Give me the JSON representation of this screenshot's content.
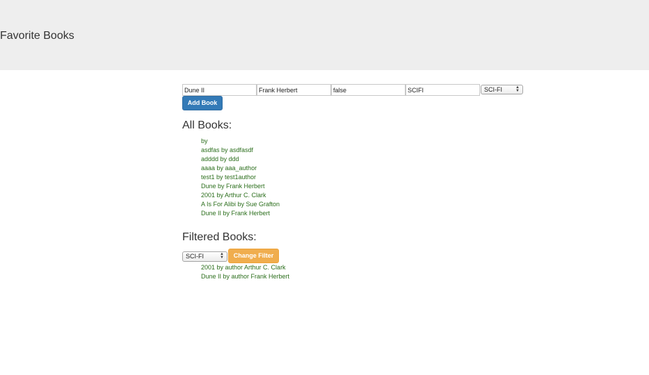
{
  "header": {
    "title": "Favorite Books"
  },
  "form": {
    "title_value": "Dune II",
    "author_value": "Frank Herbert",
    "flag_value": "false",
    "genre_text_value": "SCIFI",
    "genre_select_value": "SCI-FI",
    "add_button_label": "Add Book"
  },
  "all_books": {
    "heading": "All Books:",
    "items": [
      "by",
      "asdfas by asdfasdf",
      "adddd by ddd",
      "aaaa by aaa_author",
      "test1 by test1author",
      "Dune by Frank Herbert",
      "2001 by Arthur C. Clark",
      "A Is For Alibi by Sue Grafton",
      "Dune II by Frank Herbert"
    ]
  },
  "filtered_books": {
    "heading": "Filtered Books:",
    "filter_select_value": "SCI-FI",
    "change_filter_label": "Change Filter",
    "items": [
      "2001 by author Arthur C. Clark",
      "Dune II by author Frank Herbert"
    ]
  },
  "colors": {
    "header_bg": "#eeeeee",
    "primary_button": "#337ab7",
    "warning_button": "#f0ad4e",
    "list_text": "#2b6e1c"
  },
  "icons": {
    "select_arrows": "up-down-chevron-icon"
  }
}
